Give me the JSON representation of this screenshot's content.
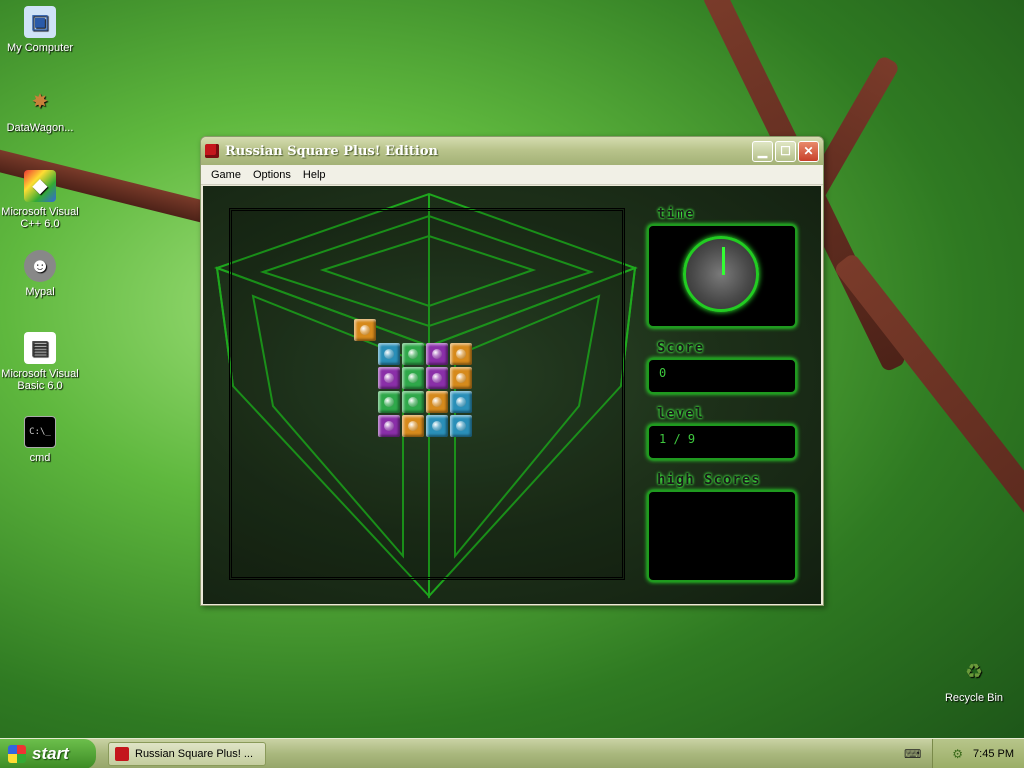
{
  "desktop": {
    "icons": [
      {
        "label": "My Computer",
        "icon": "computer-icon"
      },
      {
        "label": "DataWagon...",
        "icon": "datawagon-icon"
      },
      {
        "label": "Microsoft Visual C++ 6.0",
        "icon": "visual-cpp-icon"
      },
      {
        "label": "Mypal",
        "icon": "mypal-icon"
      },
      {
        "label": "Microsoft Visual Basic 6.0",
        "icon": "visual-basic-icon"
      },
      {
        "label": "cmd",
        "icon": "cmd-icon"
      },
      {
        "label": "Recycle Bin",
        "icon": "recycle-bin-icon"
      }
    ]
  },
  "window": {
    "title": "Russian Square Plus! Edition",
    "menu": [
      "Game",
      "Options",
      "Help"
    ],
    "panels": {
      "time_label": "time",
      "score_label": "Score",
      "score_value": "0",
      "level_label": "level",
      "level_value": "1 / 9",
      "highscores_label": "high Scores"
    },
    "blocks": [
      {
        "row": 0,
        "col": 0,
        "color": "#d68a1c"
      },
      {
        "row": 1,
        "col": 1,
        "color": "#2a8fb8"
      },
      {
        "row": 1,
        "col": 2,
        "color": "#2fa84a"
      },
      {
        "row": 1,
        "col": 3,
        "color": "#8a2fa8"
      },
      {
        "row": 1,
        "col": 4,
        "color": "#d68a1c"
      },
      {
        "row": 2,
        "col": 1,
        "color": "#8a2fa8"
      },
      {
        "row": 2,
        "col": 2,
        "color": "#2fa84a"
      },
      {
        "row": 2,
        "col": 3,
        "color": "#8a2fa8"
      },
      {
        "row": 2,
        "col": 4,
        "color": "#d68a1c"
      },
      {
        "row": 3,
        "col": 1,
        "color": "#2fa84a"
      },
      {
        "row": 3,
        "col": 2,
        "color": "#2fa84a"
      },
      {
        "row": 3,
        "col": 3,
        "color": "#d68a1c"
      },
      {
        "row": 3,
        "col": 4,
        "color": "#2a8fb8"
      },
      {
        "row": 4,
        "col": 1,
        "color": "#8a2fa8"
      },
      {
        "row": 4,
        "col": 2,
        "color": "#d68a1c"
      },
      {
        "row": 4,
        "col": 3,
        "color": "#2a8fb8"
      },
      {
        "row": 4,
        "col": 4,
        "color": "#2a8fb8"
      }
    ]
  },
  "taskbar": {
    "start_label": "start",
    "task_label": "Russian Square Plus! ...",
    "clock": "7:45 PM"
  }
}
